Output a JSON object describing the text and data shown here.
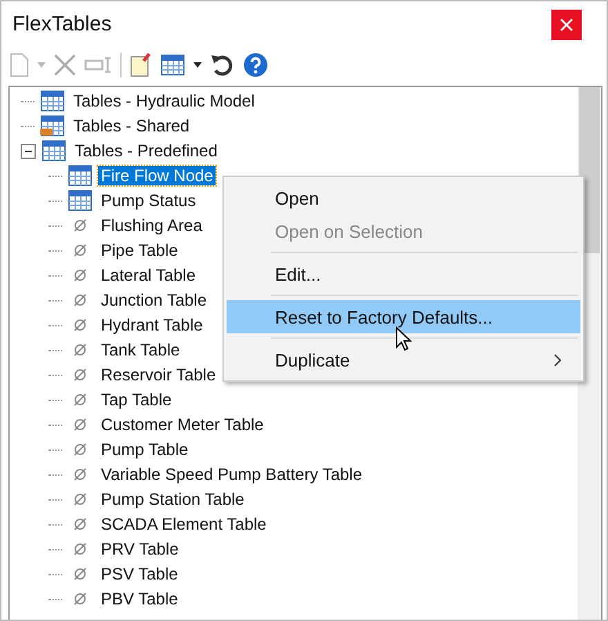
{
  "window": {
    "title": "FlexTables"
  },
  "tree": [
    {
      "label": "Tables - Hydraulic Model",
      "kind": "table",
      "selected": false
    },
    {
      "label": "Tables - Shared",
      "kind": "shared",
      "selected": false
    },
    {
      "label": "Tables - Predefined",
      "kind": "table",
      "selected": false,
      "expanded": true,
      "children": [
        {
          "label": "Fire Flow Node",
          "kind": "table",
          "selected": true
        },
        {
          "label": "Pump Status",
          "kind": "table",
          "selected": false
        },
        {
          "label": "Flushing Area",
          "kind": "predefined",
          "selected": false
        },
        {
          "label": "Pipe Table",
          "kind": "predefined",
          "selected": false
        },
        {
          "label": "Lateral Table",
          "kind": "predefined",
          "selected": false
        },
        {
          "label": "Junction Table",
          "kind": "predefined",
          "selected": false
        },
        {
          "label": "Hydrant Table",
          "kind": "predefined",
          "selected": false
        },
        {
          "label": "Tank Table",
          "kind": "predefined",
          "selected": false
        },
        {
          "label": "Reservoir Table",
          "kind": "predefined",
          "selected": false
        },
        {
          "label": "Tap Table",
          "kind": "predefined",
          "selected": false
        },
        {
          "label": "Customer Meter Table",
          "kind": "predefined",
          "selected": false
        },
        {
          "label": "Pump Table",
          "kind": "predefined",
          "selected": false
        },
        {
          "label": "Variable Speed Pump Battery Table",
          "kind": "predefined",
          "selected": false
        },
        {
          "label": "Pump Station Table",
          "kind": "predefined",
          "selected": false
        },
        {
          "label": "SCADA Element Table",
          "kind": "predefined",
          "selected": false
        },
        {
          "label": "PRV Table",
          "kind": "predefined",
          "selected": false
        },
        {
          "label": "PSV Table",
          "kind": "predefined",
          "selected": false
        },
        {
          "label": "PBV Table",
          "kind": "predefined",
          "selected": false
        }
      ]
    }
  ],
  "context_menu": [
    {
      "label": "Open",
      "disabled": false,
      "selected": false
    },
    {
      "label": "Open on Selection",
      "disabled": true,
      "selected": false,
      "separator_after": true
    },
    {
      "label": "Edit...",
      "disabled": false,
      "selected": false,
      "separator_after": true
    },
    {
      "label": "Reset to Factory Defaults...",
      "disabled": false,
      "selected": true,
      "separator_after": true
    },
    {
      "label": "Duplicate",
      "disabled": false,
      "selected": false,
      "submenu": true
    }
  ]
}
